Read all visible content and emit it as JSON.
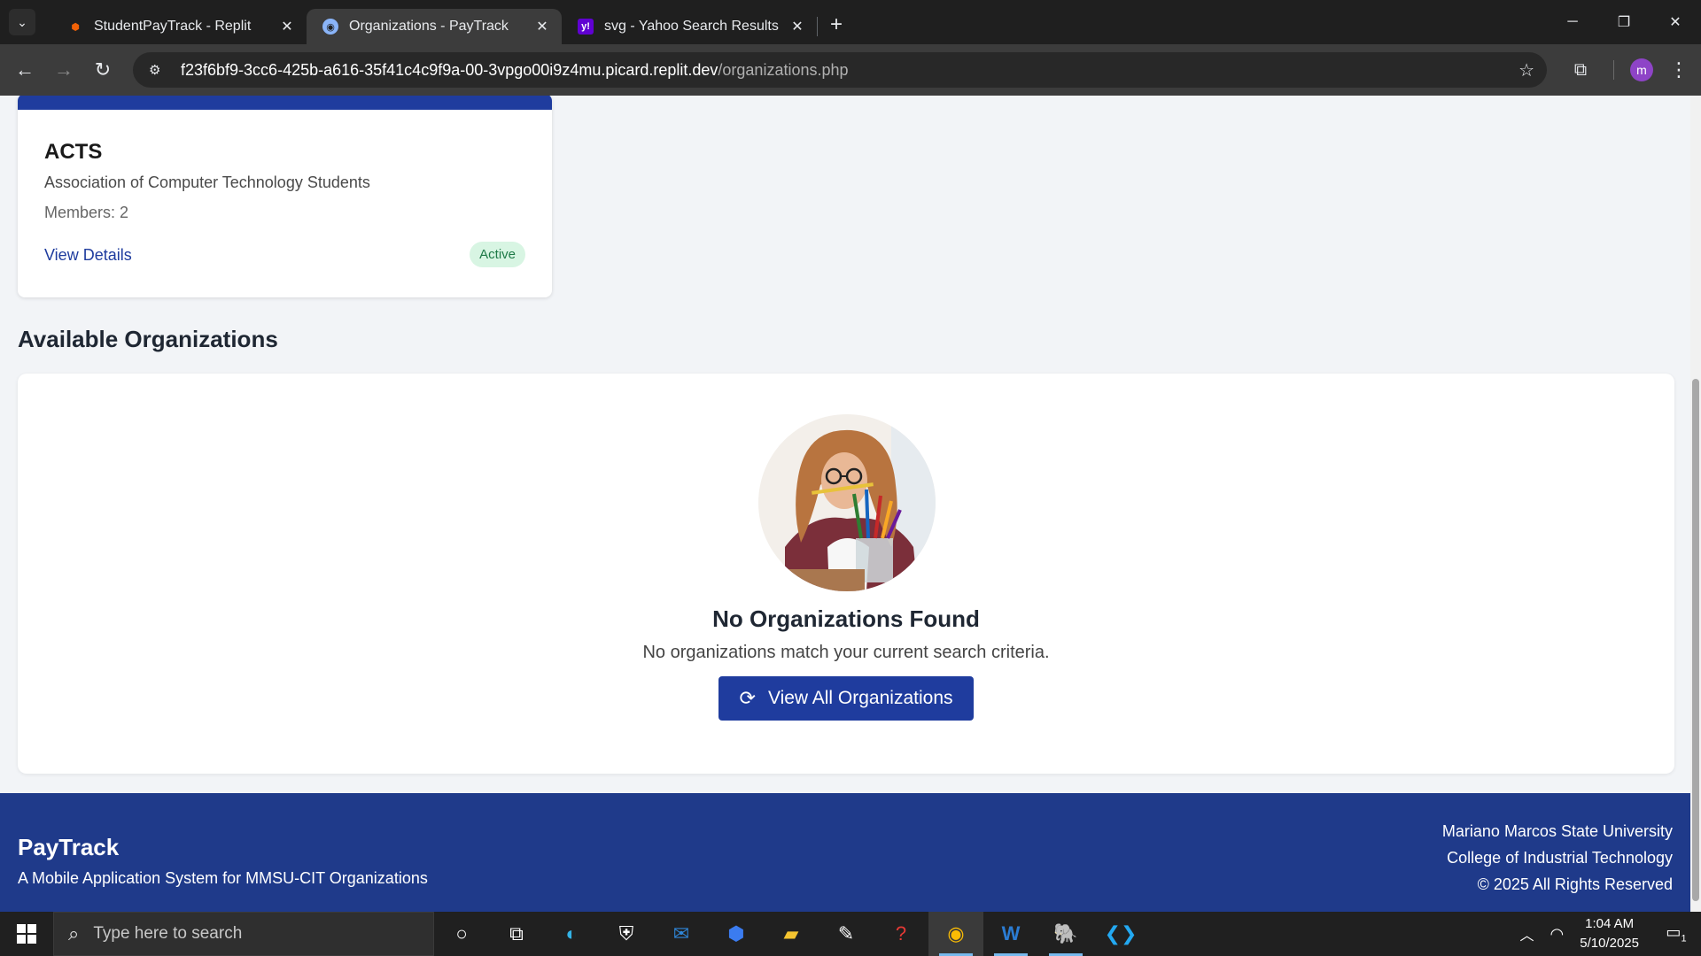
{
  "browser": {
    "tabs": [
      {
        "title": "StudentPayTrack - Replit",
        "favicon": "replit-icon"
      },
      {
        "title": "Organizations - PayTrack",
        "favicon": "globe-icon",
        "active": true
      },
      {
        "title": "svg - Yahoo Search Results",
        "favicon": "yahoo-icon"
      }
    ],
    "url_host": "f23f6bf9-3cc6-425b-a616-35f41c4c9f9a-00-3vpgo00i9z4mu.picard.replit.dev",
    "url_path": "/organizations.php",
    "profile_initial": "m"
  },
  "org_card": {
    "acronym": "ACTS",
    "name": "Association of Computer Technology Students",
    "members": "Members: 2",
    "details_link": "View Details",
    "status": "Active",
    "accent_color": "#1f3c9e"
  },
  "available": {
    "title": "Available Organizations",
    "empty_title": "No Organizations Found",
    "empty_text": "No organizations match your current search criteria.",
    "button_label": "View All Organizations"
  },
  "footer": {
    "brand": "PayTrack",
    "tagline": "A Mobile Application System for MMSU-CIT Organizations",
    "university": "Mariano Marcos State University",
    "college": "College of Industrial Technology",
    "copyright": "© 2025 All Rights Reserved",
    "bg_color": "#1f3a8a"
  },
  "taskbar": {
    "search_placeholder": "Type here to search",
    "time": "1:04 AM",
    "date": "5/10/2025",
    "notification_count": "1"
  }
}
